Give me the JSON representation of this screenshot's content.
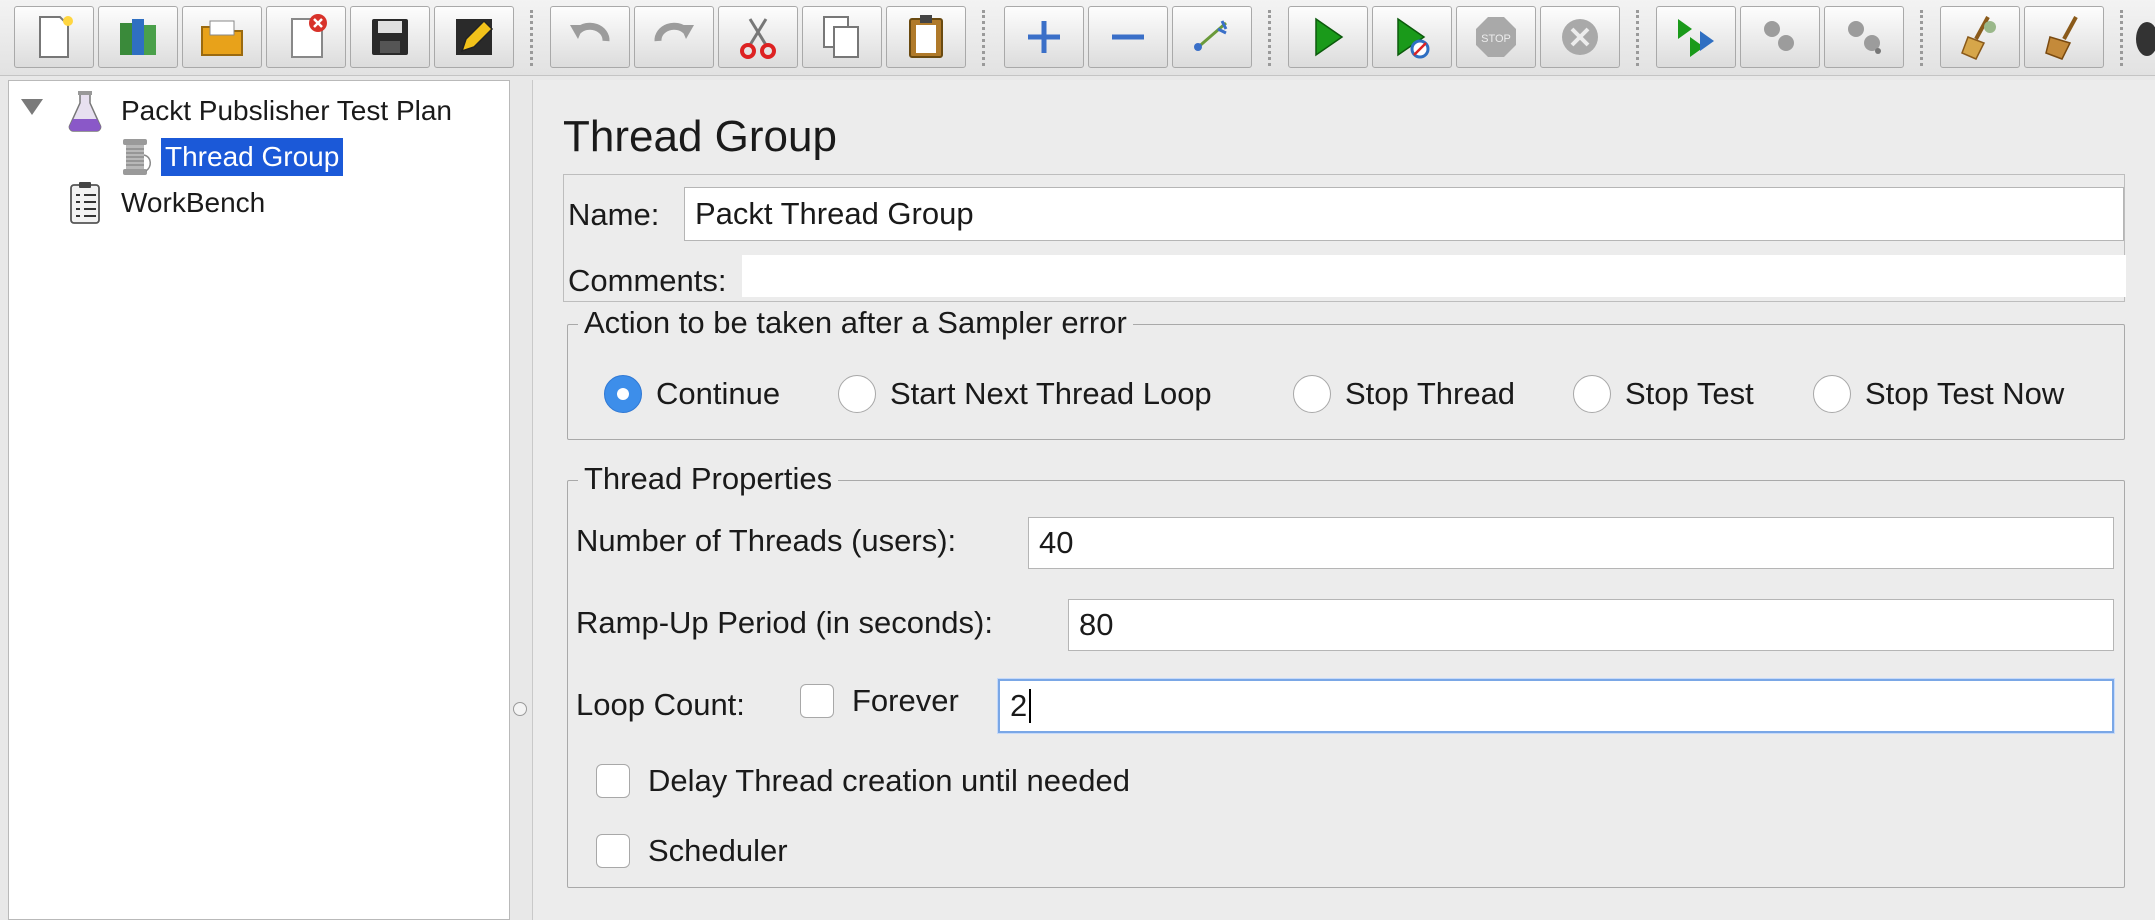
{
  "tree": {
    "items": [
      {
        "label": "Packt Pubslisher Test Plan",
        "icon": "test-plan-flask-icon"
      },
      {
        "label": "Thread Group",
        "icon": "thread-group-spool-icon",
        "selected": true
      },
      {
        "label": "WorkBench",
        "icon": "workbench-clipboard-icon"
      }
    ]
  },
  "panel": {
    "title": "Thread Group",
    "name_label": "Name:",
    "name_value": "Packt Thread Group",
    "comments_label": "Comments:",
    "comments_value": "",
    "sampler_error": {
      "legend": "Action to be taken after a Sampler error",
      "options": [
        {
          "label": "Continue",
          "checked": true
        },
        {
          "label": "Start Next Thread Loop",
          "checked": false
        },
        {
          "label": "Stop Thread",
          "checked": false
        },
        {
          "label": "Stop Test",
          "checked": false
        },
        {
          "label": "Stop Test Now",
          "checked": false
        }
      ]
    },
    "thread_properties": {
      "legend": "Thread Properties",
      "threads_label": "Number of Threads (users):",
      "threads_value": "40",
      "rampup_label": "Ramp-Up Period (in seconds):",
      "rampup_value": "80",
      "loop_label": "Loop Count:",
      "forever_label": "Forever",
      "loop_value": "2",
      "delay_label": "Delay Thread creation until needed",
      "scheduler_label": "Scheduler"
    }
  },
  "colors": {
    "selection": "#1b59d8",
    "radio_checked": "#3d8eea",
    "run_green": "#1a9a1a"
  }
}
